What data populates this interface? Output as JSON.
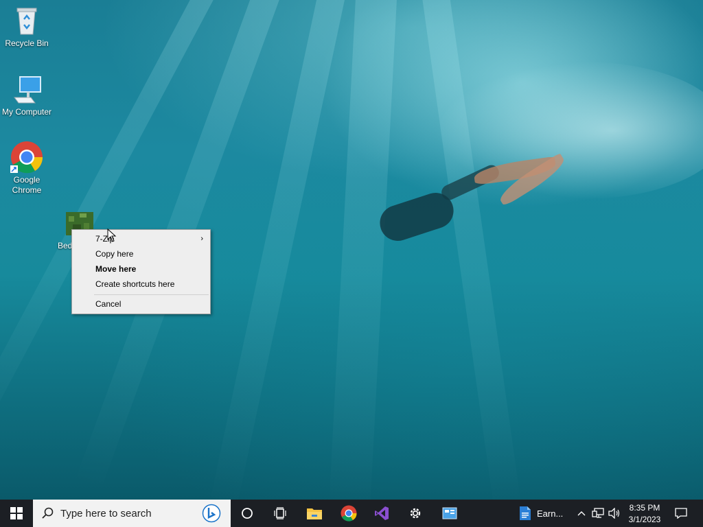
{
  "desktop": {
    "icons": [
      {
        "label": "Recycle Bin"
      },
      {
        "label": "My Computer"
      },
      {
        "label": "Google Chrome"
      },
      {
        "label": "Bed"
      }
    ]
  },
  "context_menu": {
    "items": [
      {
        "label": "7-Zip",
        "has_submenu": true,
        "bold": false
      },
      {
        "label": "Copy here",
        "bold": false
      },
      {
        "label": "Move here",
        "bold": true
      },
      {
        "label": "Create shortcuts here",
        "bold": false
      },
      {
        "label": "Cancel",
        "bold": false
      }
    ],
    "submenu_arrow": "›"
  },
  "taskbar": {
    "search_placeholder": "Type here to search",
    "pinned": [
      "windows-start",
      "cortana",
      "task-view",
      "file-explorer",
      "google-chrome",
      "visual-studio",
      "settings",
      "control-panel"
    ],
    "open_window_label": "Earn...",
    "tray": {
      "time": "8:35 PM",
      "date": "3/1/2023",
      "chevron": "^"
    }
  },
  "colors": {
    "taskbar_bg": "#1c1f24",
    "menu_bg": "#eeeeee",
    "desktop_water": "#1a7e95"
  }
}
